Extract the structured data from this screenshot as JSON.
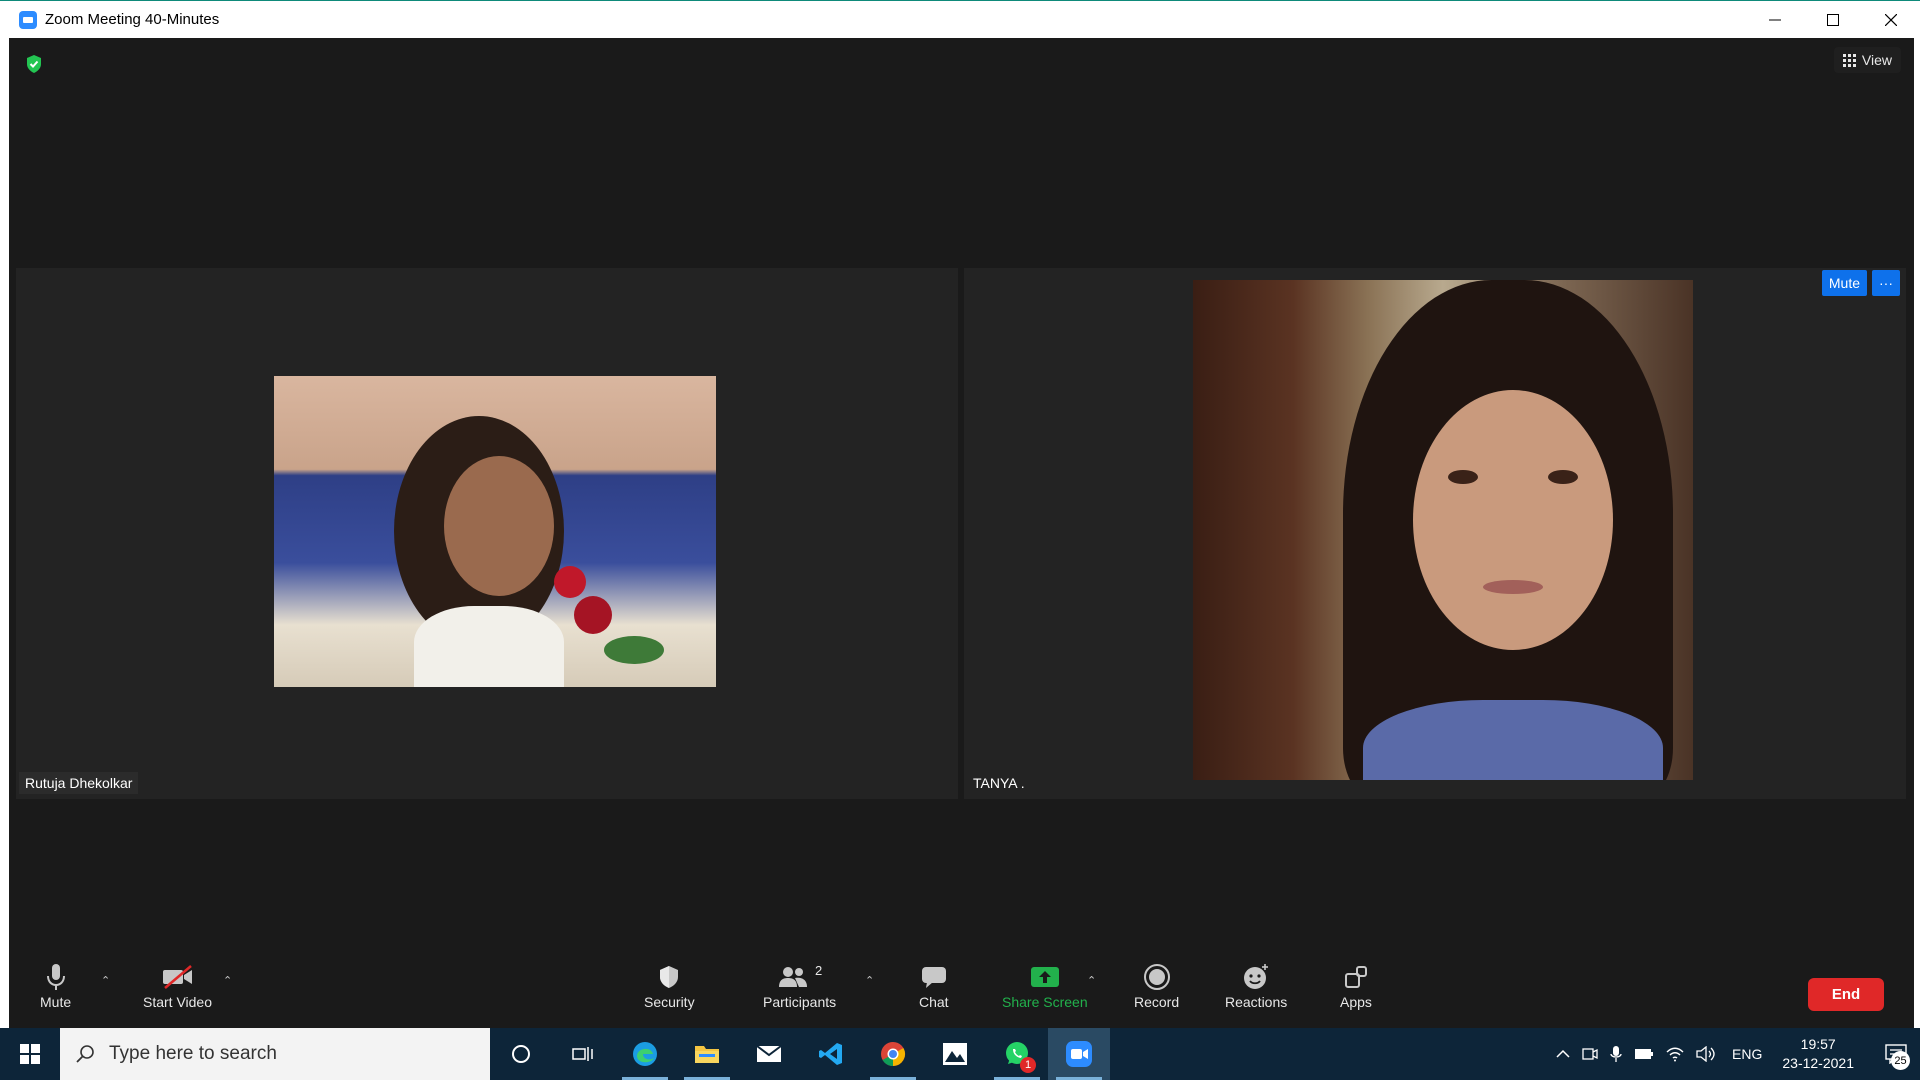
{
  "window": {
    "title": "Zoom Meeting 40-Minutes"
  },
  "header": {
    "view_label": "View"
  },
  "participants_tiles": [
    {
      "name": "Rutuja Dhekolkar"
    },
    {
      "name": "TANYA .",
      "mute_label": "Mute",
      "more_label": "···"
    }
  ],
  "toolbar": {
    "mute_label": "Mute",
    "start_video_label": "Start Video",
    "security_label": "Security",
    "participants_label": "Participants",
    "participants_count": "2",
    "chat_label": "Chat",
    "share_screen_label": "Share Screen",
    "record_label": "Record",
    "reactions_label": "Reactions",
    "apps_label": "Apps",
    "end_label": "End"
  },
  "taskbar": {
    "search_placeholder": "Type here to search",
    "whatsapp_badge": "1",
    "language": "ENG",
    "time": "19:57",
    "date": "23-12-2021",
    "notification_count": "25"
  },
  "colors": {
    "zoom_blue": "#0e71eb",
    "share_green": "#22b14c",
    "end_red": "#e02828",
    "taskbar_bg": "#0d2539"
  }
}
